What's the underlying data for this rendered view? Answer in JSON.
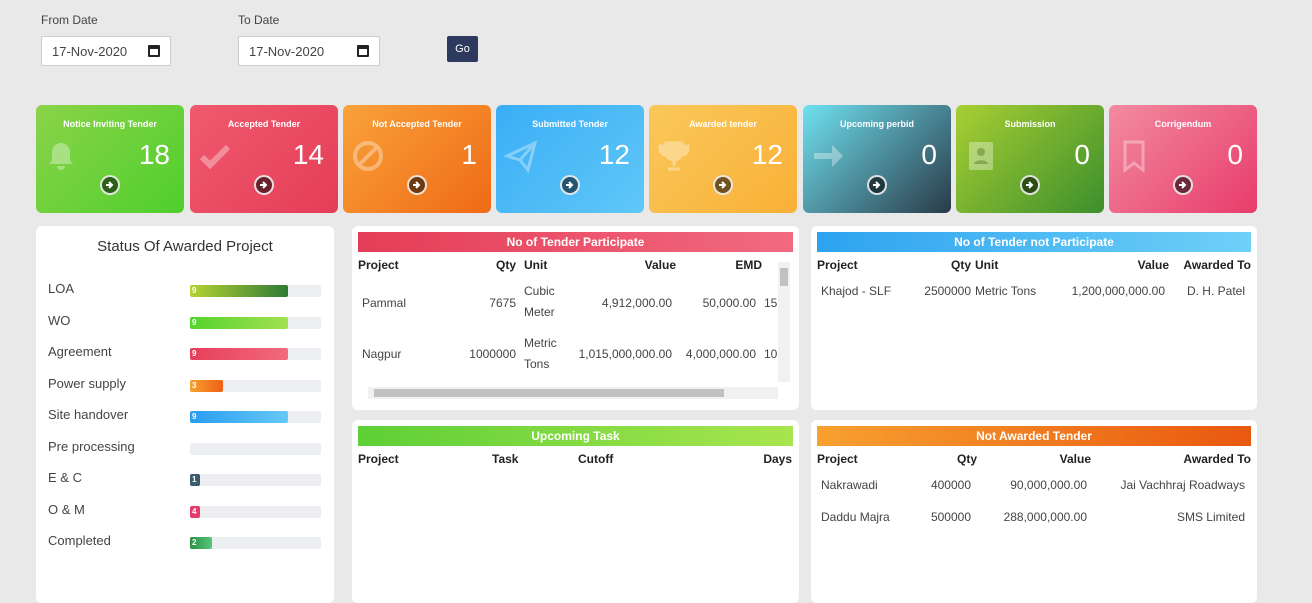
{
  "filters": {
    "from_label": "From Date",
    "from_value": "17-Nov-2020",
    "to_label": "To Date",
    "to_value": "17-Nov-2020",
    "go_label": "Go"
  },
  "cards": [
    {
      "title": "Notice Inviting Tender",
      "count": "18",
      "icon": "bell-icon",
      "gradient": [
        "#8bd34a",
        "#4fcf2c"
      ]
    },
    {
      "title": "Accepted Tender",
      "count": "14",
      "icon": "check-icon",
      "gradient": [
        "#f05a6e",
        "#e43d57"
      ]
    },
    {
      "title": "Not Accepted Tender",
      "count": "1",
      "icon": "ban-icon",
      "gradient": [
        "#f9a23b",
        "#ef6a15"
      ]
    },
    {
      "title": "Submitted Tender",
      "count": "12",
      "icon": "paper-plane-icon",
      "gradient": [
        "#3aaef5",
        "#60c7f8"
      ]
    },
    {
      "title": "Awarded tender",
      "count": "12",
      "icon": "trophy-icon",
      "gradient": [
        "#f9c85a",
        "#f9b037"
      ]
    },
    {
      "title": "Upcoming perbid",
      "count": "0",
      "icon": "arrow-right-icon",
      "gradient": [
        "#6fe1f0",
        "#2a3a48"
      ]
    },
    {
      "title": "Submission",
      "count": "0",
      "icon": "contact-book-icon",
      "gradient": [
        "#a8cf33",
        "#3c8f2c"
      ]
    },
    {
      "title": "Corrigendum",
      "count": "0",
      "icon": "bookmark-icon",
      "gradient": [
        "#f28ba0",
        "#e83c6a"
      ]
    }
  ],
  "status": {
    "title": "Status Of Awarded Project",
    "items": [
      {
        "label": "LOA",
        "value": "9",
        "fraction": 0.75,
        "colors": [
          "#b5d334",
          "#2f7a35"
        ]
      },
      {
        "label": "WO",
        "value": "9",
        "fraction": 0.75,
        "colors": [
          "#55d32d",
          "#a2e052"
        ]
      },
      {
        "label": "Agreement",
        "value": "9",
        "fraction": 0.75,
        "colors": [
          "#e63f5b",
          "#f36a7c"
        ]
      },
      {
        "label": "Power supply",
        "value": "3",
        "fraction": 0.25,
        "colors": [
          "#f6a12f",
          "#ef6016"
        ]
      },
      {
        "label": "Site handover",
        "value": "9",
        "fraction": 0.75,
        "colors": [
          "#2a9df1",
          "#66c8f7"
        ]
      },
      {
        "label": "Pre processing",
        "value": "",
        "fraction": 0.0,
        "colors": [
          "#eceef1",
          "#eceef1"
        ]
      },
      {
        "label": "E & C",
        "value": "1",
        "fraction": 0.08,
        "colors": [
          "#3b5b6e",
          "#3b5b6e"
        ]
      },
      {
        "label": "O & M",
        "value": "4",
        "fraction": 0.08,
        "colors": [
          "#e53d6a",
          "#e53d6a"
        ]
      },
      {
        "label": "Completed",
        "value": "2",
        "fraction": 0.17,
        "colors": [
          "#2e8f45",
          "#56c77a"
        ]
      }
    ]
  },
  "participate": {
    "title": "No of Tender Participate",
    "headers": [
      "Project",
      "Qty",
      "Unit",
      "Value",
      "EMD"
    ],
    "rows": [
      {
        "project": "Pammal",
        "qty": "7675",
        "unit_1": "Cubic",
        "unit_2": "Meter",
        "value": "4,912,000.00",
        "emd": "50,000.00",
        "extra": "15"
      },
      {
        "project": "Nagpur",
        "qty": "1000000",
        "unit_1": "Metric",
        "unit_2": "Tons",
        "value": "1,015,000,000.00",
        "emd": "4,000,000.00",
        "extra": "10"
      }
    ]
  },
  "not_participate": {
    "title": "No of Tender not Participate",
    "headers": [
      "Project",
      "Qty",
      "Unit",
      "Value",
      "Awarded To"
    ],
    "rows": [
      {
        "project": "Khajod - SLF",
        "qty": "2500000",
        "unit": "Metric Tons",
        "value": "1,200,000,000.00",
        "awarded_to": "D. H. Patel"
      }
    ]
  },
  "upcoming": {
    "title": "Upcoming Task",
    "headers": [
      "Project",
      "Task",
      "Cutoff",
      "Days"
    ]
  },
  "not_awarded": {
    "title": "Not Awarded Tender",
    "headers": [
      "Project",
      "Qty",
      "Value",
      "Awarded To"
    ],
    "rows": [
      {
        "project": "Nakrawadi",
        "qty": "400000",
        "value": "90,000,000.00",
        "awarded_to": "Jai Vachhraj Roadways"
      },
      {
        "project": "Daddu Majra",
        "qty": "500000",
        "value": "288,000,000.00",
        "awarded_to": "SMS Limited"
      }
    ]
  }
}
